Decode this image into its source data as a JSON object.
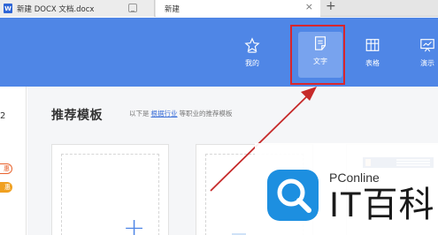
{
  "tabs": {
    "doc_icon": "W",
    "doc_title": "新建 DOCX 文档.docx",
    "new_title": "新建",
    "add": "+",
    "close": "×"
  },
  "toolbar": {
    "items": [
      {
        "label": "我的",
        "icon": "star-icon"
      },
      {
        "label": "文字",
        "icon": "document-icon"
      },
      {
        "label": "表格",
        "icon": "table-icon"
      },
      {
        "label": "演示",
        "icon": "presentation-icon"
      }
    ],
    "accent": "#4f86e6",
    "highlight_color": "#d8262c"
  },
  "left": {
    "number": "2",
    "badge1": "惠",
    "badge2": "惠"
  },
  "main": {
    "section_title": "推荐模板",
    "hint_prefix": "以下是",
    "hint_link": "根据行业",
    "hint_suffix": "等职业的推荐模板",
    "plus": "+"
  },
  "watermark": {
    "brand_small": "PConline",
    "brand_big": "IT百科"
  }
}
